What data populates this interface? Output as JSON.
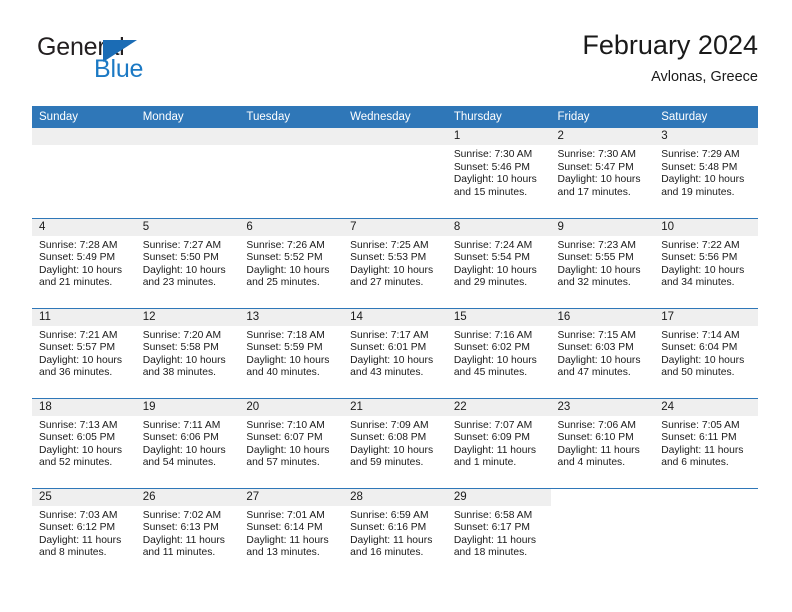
{
  "brand": {
    "name_part1": "General",
    "name_part2": "Blue",
    "flag_icon": "blue-flag-triangle"
  },
  "header": {
    "title": "February 2024",
    "subtitle": "Avlonas, Greece"
  },
  "colors": {
    "header_blue": "#2f77b8",
    "brand_blue": "#1b79c4",
    "daynum_band": "#efefef",
    "text": "#1a1a1a"
  },
  "weekday_headers": [
    "Sunday",
    "Monday",
    "Tuesday",
    "Wednesday",
    "Thursday",
    "Friday",
    "Saturday"
  ],
  "labels": {
    "sunrise_prefix": "Sunrise:",
    "sunset_prefix": "Sunset:",
    "daylight_prefix": "Daylight:"
  },
  "weeks": [
    [
      {
        "day": "",
        "empty": true,
        "sunrise": "",
        "sunset": "",
        "daylight_line1": "",
        "daylight_line2": ""
      },
      {
        "day": "",
        "empty": true,
        "sunrise": "",
        "sunset": "",
        "daylight_line1": "",
        "daylight_line2": ""
      },
      {
        "day": "",
        "empty": true,
        "sunrise": "",
        "sunset": "",
        "daylight_line1": "",
        "daylight_line2": ""
      },
      {
        "day": "",
        "empty": true,
        "sunrise": "",
        "sunset": "",
        "daylight_line1": "",
        "daylight_line2": ""
      },
      {
        "day": "1",
        "empty": false,
        "sunrise": "Sunrise: 7:30 AM",
        "sunset": "Sunset: 5:46 PM",
        "daylight_line1": "Daylight: 10 hours",
        "daylight_line2": "and 15 minutes."
      },
      {
        "day": "2",
        "empty": false,
        "sunrise": "Sunrise: 7:30 AM",
        "sunset": "Sunset: 5:47 PM",
        "daylight_line1": "Daylight: 10 hours",
        "daylight_line2": "and 17 minutes."
      },
      {
        "day": "3",
        "empty": false,
        "sunrise": "Sunrise: 7:29 AM",
        "sunset": "Sunset: 5:48 PM",
        "daylight_line1": "Daylight: 10 hours",
        "daylight_line2": "and 19 minutes."
      }
    ],
    [
      {
        "day": "4",
        "empty": false,
        "sunrise": "Sunrise: 7:28 AM",
        "sunset": "Sunset: 5:49 PM",
        "daylight_line1": "Daylight: 10 hours",
        "daylight_line2": "and 21 minutes."
      },
      {
        "day": "5",
        "empty": false,
        "sunrise": "Sunrise: 7:27 AM",
        "sunset": "Sunset: 5:50 PM",
        "daylight_line1": "Daylight: 10 hours",
        "daylight_line2": "and 23 minutes."
      },
      {
        "day": "6",
        "empty": false,
        "sunrise": "Sunrise: 7:26 AM",
        "sunset": "Sunset: 5:52 PM",
        "daylight_line1": "Daylight: 10 hours",
        "daylight_line2": "and 25 minutes."
      },
      {
        "day": "7",
        "empty": false,
        "sunrise": "Sunrise: 7:25 AM",
        "sunset": "Sunset: 5:53 PM",
        "daylight_line1": "Daylight: 10 hours",
        "daylight_line2": "and 27 minutes."
      },
      {
        "day": "8",
        "empty": false,
        "sunrise": "Sunrise: 7:24 AM",
        "sunset": "Sunset: 5:54 PM",
        "daylight_line1": "Daylight: 10 hours",
        "daylight_line2": "and 29 minutes."
      },
      {
        "day": "9",
        "empty": false,
        "sunrise": "Sunrise: 7:23 AM",
        "sunset": "Sunset: 5:55 PM",
        "daylight_line1": "Daylight: 10 hours",
        "daylight_line2": "and 32 minutes."
      },
      {
        "day": "10",
        "empty": false,
        "sunrise": "Sunrise: 7:22 AM",
        "sunset": "Sunset: 5:56 PM",
        "daylight_line1": "Daylight: 10 hours",
        "daylight_line2": "and 34 minutes."
      }
    ],
    [
      {
        "day": "11",
        "empty": false,
        "sunrise": "Sunrise: 7:21 AM",
        "sunset": "Sunset: 5:57 PM",
        "daylight_line1": "Daylight: 10 hours",
        "daylight_line2": "and 36 minutes."
      },
      {
        "day": "12",
        "empty": false,
        "sunrise": "Sunrise: 7:20 AM",
        "sunset": "Sunset: 5:58 PM",
        "daylight_line1": "Daylight: 10 hours",
        "daylight_line2": "and 38 minutes."
      },
      {
        "day": "13",
        "empty": false,
        "sunrise": "Sunrise: 7:18 AM",
        "sunset": "Sunset: 5:59 PM",
        "daylight_line1": "Daylight: 10 hours",
        "daylight_line2": "and 40 minutes."
      },
      {
        "day": "14",
        "empty": false,
        "sunrise": "Sunrise: 7:17 AM",
        "sunset": "Sunset: 6:01 PM",
        "daylight_line1": "Daylight: 10 hours",
        "daylight_line2": "and 43 minutes."
      },
      {
        "day": "15",
        "empty": false,
        "sunrise": "Sunrise: 7:16 AM",
        "sunset": "Sunset: 6:02 PM",
        "daylight_line1": "Daylight: 10 hours",
        "daylight_line2": "and 45 minutes."
      },
      {
        "day": "16",
        "empty": false,
        "sunrise": "Sunrise: 7:15 AM",
        "sunset": "Sunset: 6:03 PM",
        "daylight_line1": "Daylight: 10 hours",
        "daylight_line2": "and 47 minutes."
      },
      {
        "day": "17",
        "empty": false,
        "sunrise": "Sunrise: 7:14 AM",
        "sunset": "Sunset: 6:04 PM",
        "daylight_line1": "Daylight: 10 hours",
        "daylight_line2": "and 50 minutes."
      }
    ],
    [
      {
        "day": "18",
        "empty": false,
        "sunrise": "Sunrise: 7:13 AM",
        "sunset": "Sunset: 6:05 PM",
        "daylight_line1": "Daylight: 10 hours",
        "daylight_line2": "and 52 minutes."
      },
      {
        "day": "19",
        "empty": false,
        "sunrise": "Sunrise: 7:11 AM",
        "sunset": "Sunset: 6:06 PM",
        "daylight_line1": "Daylight: 10 hours",
        "daylight_line2": "and 54 minutes."
      },
      {
        "day": "20",
        "empty": false,
        "sunrise": "Sunrise: 7:10 AM",
        "sunset": "Sunset: 6:07 PM",
        "daylight_line1": "Daylight: 10 hours",
        "daylight_line2": "and 57 minutes."
      },
      {
        "day": "21",
        "empty": false,
        "sunrise": "Sunrise: 7:09 AM",
        "sunset": "Sunset: 6:08 PM",
        "daylight_line1": "Daylight: 10 hours",
        "daylight_line2": "and 59 minutes."
      },
      {
        "day": "22",
        "empty": false,
        "sunrise": "Sunrise: 7:07 AM",
        "sunset": "Sunset: 6:09 PM",
        "daylight_line1": "Daylight: 11 hours",
        "daylight_line2": "and 1 minute."
      },
      {
        "day": "23",
        "empty": false,
        "sunrise": "Sunrise: 7:06 AM",
        "sunset": "Sunset: 6:10 PM",
        "daylight_line1": "Daylight: 11 hours",
        "daylight_line2": "and 4 minutes."
      },
      {
        "day": "24",
        "empty": false,
        "sunrise": "Sunrise: 7:05 AM",
        "sunset": "Sunset: 6:11 PM",
        "daylight_line1": "Daylight: 11 hours",
        "daylight_line2": "and 6 minutes."
      }
    ],
    [
      {
        "day": "25",
        "empty": false,
        "sunrise": "Sunrise: 7:03 AM",
        "sunset": "Sunset: 6:12 PM",
        "daylight_line1": "Daylight: 11 hours",
        "daylight_line2": "and 8 minutes."
      },
      {
        "day": "26",
        "empty": false,
        "sunrise": "Sunrise: 7:02 AM",
        "sunset": "Sunset: 6:13 PM",
        "daylight_line1": "Daylight: 11 hours",
        "daylight_line2": "and 11 minutes."
      },
      {
        "day": "27",
        "empty": false,
        "sunrise": "Sunrise: 7:01 AM",
        "sunset": "Sunset: 6:14 PM",
        "daylight_line1": "Daylight: 11 hours",
        "daylight_line2": "and 13 minutes."
      },
      {
        "day": "28",
        "empty": false,
        "sunrise": "Sunrise: 6:59 AM",
        "sunset": "Sunset: 6:16 PM",
        "daylight_line1": "Daylight: 11 hours",
        "daylight_line2": "and 16 minutes."
      },
      {
        "day": "29",
        "empty": false,
        "sunrise": "Sunrise: 6:58 AM",
        "sunset": "Sunset: 6:17 PM",
        "daylight_line1": "Daylight: 11 hours",
        "daylight_line2": "and 18 minutes."
      },
      {
        "day": "",
        "empty": true,
        "blank": true,
        "sunrise": "",
        "sunset": "",
        "daylight_line1": "",
        "daylight_line2": ""
      },
      {
        "day": "",
        "empty": true,
        "blank": true,
        "sunrise": "",
        "sunset": "",
        "daylight_line1": "",
        "daylight_line2": ""
      }
    ]
  ]
}
